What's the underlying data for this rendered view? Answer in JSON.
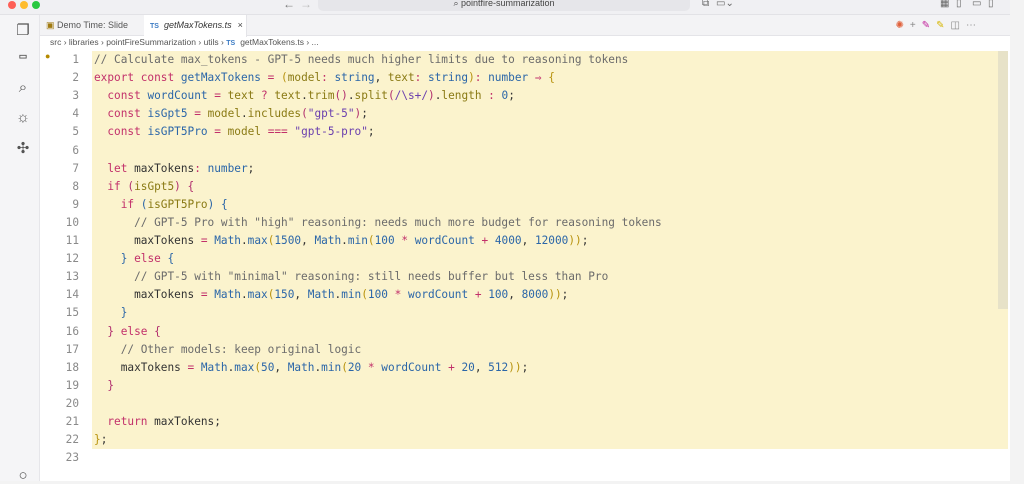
{
  "titlebar": {
    "search": "pointfire-summarization",
    "back": "←",
    "forward": "→"
  },
  "tabs": [
    {
      "label": "Demo Time: Slide"
    },
    {
      "label": "getMaxTokens.ts",
      "lang": "TS",
      "close": "×"
    }
  ],
  "breadcrumb": [
    "src",
    "libraries",
    "pointFireSummarization",
    "utils",
    "getMaxTokens.ts",
    "..."
  ],
  "breadcrumb_lang": "TS",
  "toolbar_icons": [
    "debug-icon",
    "add-icon",
    "pen-icon",
    "highlighter-icon",
    "split-icon",
    "more-icon"
  ],
  "colors": {
    "highlight": "#fbf3cd",
    "keyword": "#c2306a",
    "identifier": "#2b66a8",
    "string": "#6a3fae"
  },
  "editor": {
    "lines": [
      {
        "n": "1",
        "tokens": [
          [
            "c",
            "// Calculate max_tokens - GPT-5 needs much higher limits due to reasoning tokens"
          ]
        ]
      },
      {
        "n": "2",
        "tokens": [
          [
            "k",
            "export const "
          ],
          [
            "v",
            "getMaxTokens"
          ],
          [
            "o",
            " = "
          ],
          [
            "b",
            "("
          ],
          [
            "p",
            "model"
          ],
          [
            "o",
            ": "
          ],
          [
            "v",
            "string"
          ],
          [
            "t",
            ", "
          ],
          [
            "p",
            "text"
          ],
          [
            "o",
            ": "
          ],
          [
            "v",
            "string"
          ],
          [
            "b",
            ")"
          ],
          [
            "o",
            ": "
          ],
          [
            "v",
            "number"
          ],
          [
            "o",
            " ⇒ "
          ],
          [
            "b",
            "{"
          ]
        ]
      },
      {
        "n": "3",
        "tokens": [
          [
            "t",
            "  "
          ],
          [
            "k",
            "const "
          ],
          [
            "v",
            "wordCount"
          ],
          [
            "o",
            " = "
          ],
          [
            "p",
            "text"
          ],
          [
            "o",
            " ? "
          ],
          [
            "p",
            "text"
          ],
          [
            "t",
            "."
          ],
          [
            "p",
            "trim"
          ],
          [
            "b2",
            "()"
          ],
          [
            "t",
            "."
          ],
          [
            "p",
            "split"
          ],
          [
            "b2",
            "("
          ],
          [
            "s",
            "/\\s+/"
          ],
          [
            "b2",
            ")"
          ],
          [
            "t",
            "."
          ],
          [
            "p",
            "length"
          ],
          [
            "o",
            " : "
          ],
          [
            "n",
            "0"
          ],
          [
            "t",
            ";"
          ]
        ]
      },
      {
        "n": "4",
        "tokens": [
          [
            "t",
            "  "
          ],
          [
            "k",
            "const "
          ],
          [
            "v",
            "isGpt5"
          ],
          [
            "o",
            " = "
          ],
          [
            "p",
            "model"
          ],
          [
            "t",
            "."
          ],
          [
            "p",
            "includes"
          ],
          [
            "b2",
            "("
          ],
          [
            "s",
            "\"gpt-5\""
          ],
          [
            "b2",
            ")"
          ],
          [
            "t",
            ";"
          ]
        ]
      },
      {
        "n": "5",
        "tokens": [
          [
            "t",
            "  "
          ],
          [
            "k",
            "const "
          ],
          [
            "v",
            "isGPT5Pro"
          ],
          [
            "o",
            " = "
          ],
          [
            "p",
            "model"
          ],
          [
            "o",
            " === "
          ],
          [
            "s",
            "\"gpt-5-pro\""
          ],
          [
            "t",
            ";"
          ]
        ]
      },
      {
        "n": "6",
        "tokens": []
      },
      {
        "n": "7",
        "tokens": [
          [
            "t",
            "  "
          ],
          [
            "k",
            "let "
          ],
          [
            "t",
            "maxTokens"
          ],
          [
            "o",
            ": "
          ],
          [
            "v",
            "number"
          ],
          [
            "t",
            ";"
          ]
        ]
      },
      {
        "n": "8",
        "tokens": [
          [
            "t",
            "  "
          ],
          [
            "k",
            "if "
          ],
          [
            "b2",
            "("
          ],
          [
            "p",
            "isGpt5"
          ],
          [
            "b2",
            ")"
          ],
          [
            "t",
            " "
          ],
          [
            "b2",
            "{"
          ]
        ]
      },
      {
        "n": "9",
        "tokens": [
          [
            "t",
            "    "
          ],
          [
            "k",
            "if "
          ],
          [
            "b3",
            "("
          ],
          [
            "p",
            "isGPT5Pro"
          ],
          [
            "b3",
            ")"
          ],
          [
            "t",
            " "
          ],
          [
            "b3",
            "{"
          ]
        ]
      },
      {
        "n": "10",
        "tokens": [
          [
            "t",
            "      "
          ],
          [
            "c",
            "// GPT-5 Pro with \"high\" reasoning: needs much more budget for reasoning tokens"
          ]
        ]
      },
      {
        "n": "11",
        "tokens": [
          [
            "t",
            "      maxTokens"
          ],
          [
            "o",
            " = "
          ],
          [
            "v",
            "Math"
          ],
          [
            "t",
            "."
          ],
          [
            "v",
            "max"
          ],
          [
            "b",
            "("
          ],
          [
            "n",
            "1500"
          ],
          [
            "t",
            ", "
          ],
          [
            "v",
            "Math"
          ],
          [
            "t",
            "."
          ],
          [
            "v",
            "min"
          ],
          [
            "b",
            "("
          ],
          [
            "n",
            "100"
          ],
          [
            "o",
            " * "
          ],
          [
            "v",
            "wordCount"
          ],
          [
            "o",
            " + "
          ],
          [
            "n",
            "4000"
          ],
          [
            "t",
            ", "
          ],
          [
            "n",
            "12000"
          ],
          [
            "b",
            "))"
          ],
          [
            "t",
            ";"
          ]
        ]
      },
      {
        "n": "12",
        "tokens": [
          [
            "t",
            "    "
          ],
          [
            "b3",
            "}"
          ],
          [
            "k",
            " else "
          ],
          [
            "b3",
            "{"
          ]
        ]
      },
      {
        "n": "13",
        "tokens": [
          [
            "t",
            "      "
          ],
          [
            "c",
            "// GPT-5 with \"minimal\" reasoning: still needs buffer but less than Pro"
          ]
        ]
      },
      {
        "n": "14",
        "tokens": [
          [
            "t",
            "      maxTokens"
          ],
          [
            "o",
            " = "
          ],
          [
            "v",
            "Math"
          ],
          [
            "t",
            "."
          ],
          [
            "v",
            "max"
          ],
          [
            "b",
            "("
          ],
          [
            "n",
            "150"
          ],
          [
            "t",
            ", "
          ],
          [
            "v",
            "Math"
          ],
          [
            "t",
            "."
          ],
          [
            "v",
            "min"
          ],
          [
            "b",
            "("
          ],
          [
            "n",
            "100"
          ],
          [
            "o",
            " * "
          ],
          [
            "v",
            "wordCount"
          ],
          [
            "o",
            " + "
          ],
          [
            "n",
            "100"
          ],
          [
            "t",
            ", "
          ],
          [
            "n",
            "8000"
          ],
          [
            "b",
            "))"
          ],
          [
            "t",
            ";"
          ]
        ]
      },
      {
        "n": "15",
        "tokens": [
          [
            "t",
            "    "
          ],
          [
            "b3",
            "}"
          ]
        ]
      },
      {
        "n": "16",
        "tokens": [
          [
            "t",
            "  "
          ],
          [
            "b2",
            "}"
          ],
          [
            "k",
            " else "
          ],
          [
            "b2",
            "{"
          ]
        ]
      },
      {
        "n": "17",
        "tokens": [
          [
            "t",
            "    "
          ],
          [
            "c",
            "// Other models: keep original logic"
          ]
        ]
      },
      {
        "n": "18",
        "tokens": [
          [
            "t",
            "    maxTokens"
          ],
          [
            "o",
            " = "
          ],
          [
            "v",
            "Math"
          ],
          [
            "t",
            "."
          ],
          [
            "v",
            "max"
          ],
          [
            "b",
            "("
          ],
          [
            "n",
            "50"
          ],
          [
            "t",
            ", "
          ],
          [
            "v",
            "Math"
          ],
          [
            "t",
            "."
          ],
          [
            "v",
            "min"
          ],
          [
            "b",
            "("
          ],
          [
            "n",
            "20"
          ],
          [
            "o",
            " * "
          ],
          [
            "v",
            "wordCount"
          ],
          [
            "o",
            " + "
          ],
          [
            "n",
            "20"
          ],
          [
            "t",
            ", "
          ],
          [
            "n",
            "512"
          ],
          [
            "b",
            "))"
          ],
          [
            "t",
            ";"
          ]
        ]
      },
      {
        "n": "19",
        "tokens": [
          [
            "t",
            "  "
          ],
          [
            "b2",
            "}"
          ]
        ]
      },
      {
        "n": "20",
        "tokens": []
      },
      {
        "n": "21",
        "tokens": [
          [
            "t",
            "  "
          ],
          [
            "k",
            "return "
          ],
          [
            "t",
            "maxTokens;"
          ]
        ]
      },
      {
        "n": "22",
        "tokens": [
          [
            "b",
            "}"
          ],
          [
            "t",
            ";"
          ]
        ]
      },
      {
        "n": "23",
        "tokens": []
      }
    ]
  }
}
